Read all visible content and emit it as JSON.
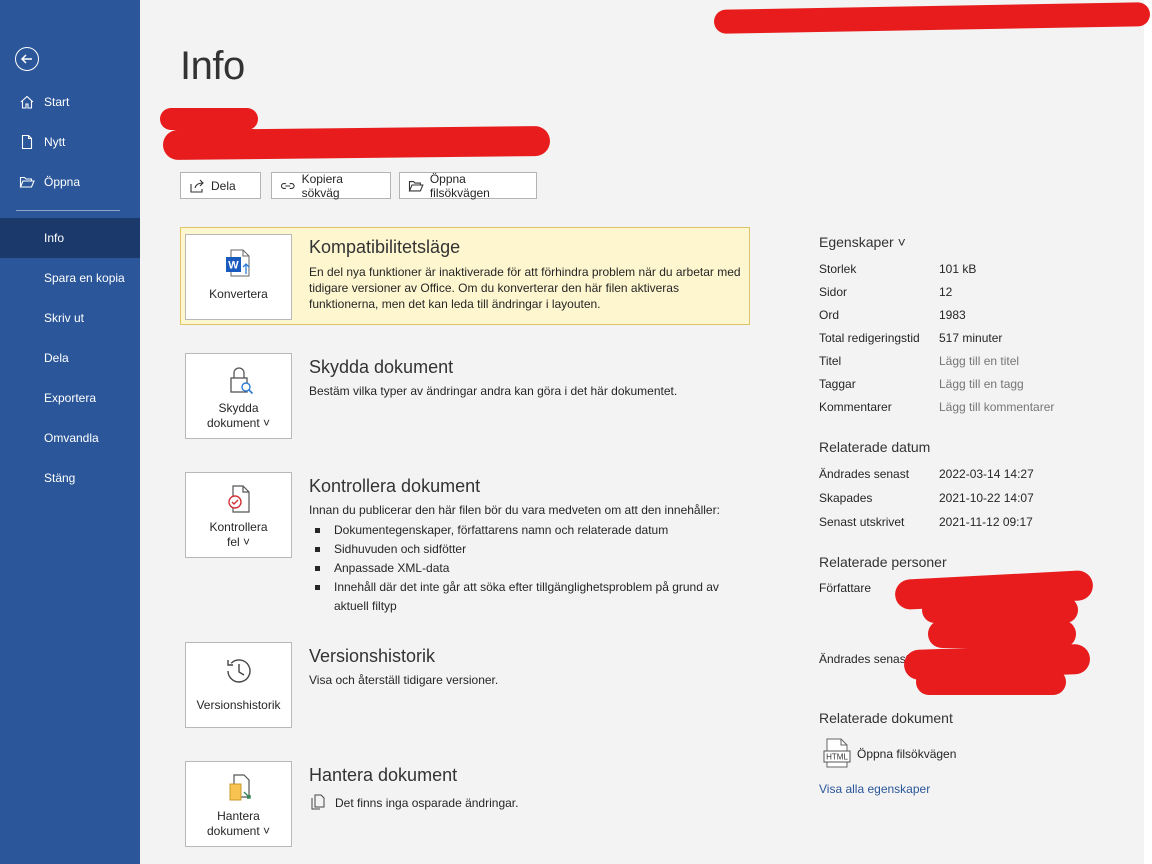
{
  "sidebar": {
    "items": [
      {
        "label": "Start"
      },
      {
        "label": "Nytt"
      },
      {
        "label": "Öppna"
      },
      {
        "label": "Info"
      },
      {
        "label": "Spara en kopia"
      },
      {
        "label": "Skriv ut"
      },
      {
        "label": "Dela"
      },
      {
        "label": "Exportera"
      },
      {
        "label": "Omvandla"
      },
      {
        "label": "Stäng"
      }
    ]
  },
  "page": {
    "title": "Info"
  },
  "toolbar": {
    "share": "Dela",
    "copy_path": "Kopiera sökväg",
    "open_location": "Öppna filsökvägen"
  },
  "sections": {
    "compat": {
      "title": "Kompatibilitetsläge",
      "desc": "En del nya funktioner är inaktiverade för att förhindra problem när du arbetar med tidigare versioner av Office. Om du konverterar den här filen aktiveras funktionerna, men det kan leda till ändringar i layouten.",
      "button": "Konvertera"
    },
    "protect": {
      "title": "Skydda dokument",
      "desc": "Bestäm vilka typer av ändringar andra kan göra i det här dokumentet.",
      "button_line1": "Skydda",
      "button_line2": "dokument ˅"
    },
    "inspect": {
      "title": "Kontrollera dokument",
      "desc": "Innan du publicerar den här filen bör du vara medveten om att den innehåller:",
      "bullets": [
        "Dokumentegenskaper, författarens namn och relaterade datum",
        "Sidhuvuden och sidfötter",
        "Anpassade XML-data",
        "Innehåll där det inte går att söka efter tillgänglighetsproblem på grund av aktuell filtyp"
      ],
      "button_line1": "Kontrollera",
      "button_line2": "fel ˅"
    },
    "versions": {
      "title": "Versionshistorik",
      "desc": "Visa och återställ tidigare versioner.",
      "button": "Versionshistorik"
    },
    "manage": {
      "title": "Hantera dokument",
      "desc": "Det finns inga osparade ändringar.",
      "button_line1": "Hantera",
      "button_line2": "dokument ˅"
    }
  },
  "properties": {
    "heading": "Egenskaper ˅",
    "rows": [
      {
        "key": "Storlek",
        "value": "101 kB"
      },
      {
        "key": "Sidor",
        "value": "12"
      },
      {
        "key": "Ord",
        "value": "1983"
      },
      {
        "key": "Total redigeringstid",
        "value": "517 minuter"
      },
      {
        "key": "Titel",
        "value": "Lägg till en titel"
      },
      {
        "key": "Taggar",
        "value": "Lägg till en tagg"
      },
      {
        "key": "Kommentarer",
        "value": "Lägg till kommentarer"
      }
    ]
  },
  "related_dates": {
    "heading": "Relaterade datum",
    "rows": [
      {
        "key": "Ändrades senast",
        "value": "2022-03-14 14:27"
      },
      {
        "key": "Skapades",
        "value": "2021-10-22 14:07"
      },
      {
        "key": "Senast utskrivet",
        "value": "2021-11-12 09:17"
      }
    ]
  },
  "related_people": {
    "heading": "Relaterade personer",
    "author_label": "Författare",
    "modified_by_label": "Ändrades senast"
  },
  "related_docs": {
    "heading": "Relaterade dokument",
    "open_location": "Öppna filsökvägen",
    "html_badge": "HTML",
    "show_all": "Visa alla egenskaper"
  },
  "colors": {
    "sidebar": "#2b579a",
    "sidebar_active": "#1b3a6b",
    "compat_bg": "#fdf6cf",
    "redaction": "#e81c1c"
  }
}
